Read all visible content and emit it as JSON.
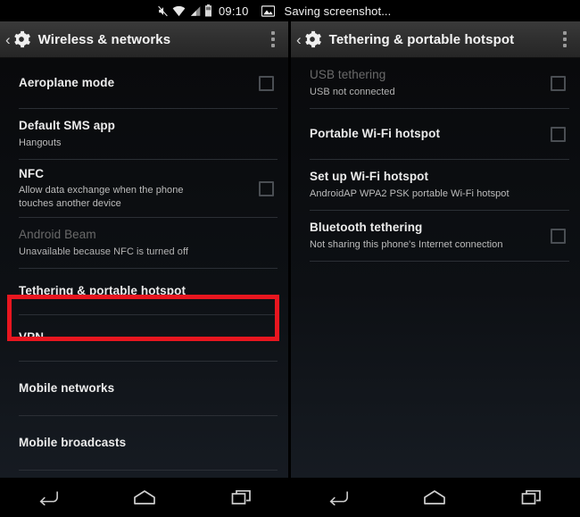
{
  "statusbar": {
    "icons": [
      "mute-icon",
      "wifi-icon",
      "cellular-signal-icon",
      "battery-icon"
    ],
    "clock": "09:10",
    "notification_icon": "screenshot-image-icon",
    "notification_text": "Saving screenshot..."
  },
  "left_panel": {
    "actionbar": {
      "back_icon": "back-chevron-icon",
      "app_icon": "settings-gear-icon",
      "title": "Wireless & networks",
      "overflow_icon": "overflow-menu-icon"
    },
    "rows": [
      {
        "title": "Aeroplane mode",
        "sub": "",
        "checkbox": true,
        "disabled": false
      },
      {
        "title": "Default SMS app",
        "sub": "Hangouts",
        "checkbox": false,
        "disabled": false
      },
      {
        "title": "NFC",
        "sub": "Allow data exchange when the phone touches another device",
        "checkbox": true,
        "disabled": false
      },
      {
        "title": "Android Beam",
        "sub": "Unavailable because NFC is turned off",
        "checkbox": false,
        "disabled": true
      },
      {
        "title": "Tethering & portable hotspot",
        "sub": "",
        "checkbox": false,
        "disabled": false
      },
      {
        "title": "VPN",
        "sub": "",
        "checkbox": false,
        "disabled": false
      },
      {
        "title": "Mobile networks",
        "sub": "",
        "checkbox": false,
        "disabled": false
      },
      {
        "title": "Mobile broadcasts",
        "sub": "",
        "checkbox": false,
        "disabled": false
      }
    ]
  },
  "right_panel": {
    "actionbar": {
      "back_icon": "back-chevron-icon",
      "app_icon": "settings-gear-icon",
      "title": "Tethering & portable hotspot",
      "overflow_icon": "overflow-menu-icon"
    },
    "rows": [
      {
        "title": "USB tethering",
        "sub": "USB not connected",
        "checkbox": true,
        "disabled": true
      },
      {
        "title": "Portable Wi-Fi hotspot",
        "sub": "",
        "checkbox": true,
        "disabled": false
      },
      {
        "title": "Set up Wi-Fi hotspot",
        "sub": "AndroidAP WPA2 PSK portable Wi-Fi hotspot",
        "checkbox": false,
        "disabled": false
      },
      {
        "title": "Bluetooth tethering",
        "sub": "Not sharing this phone's Internet connection",
        "checkbox": true,
        "disabled": false
      }
    ]
  },
  "highlight": {
    "color": "#e8161f",
    "target": "Tethering & portable hotspot"
  },
  "navbar": {
    "back_label": "back-icon",
    "home_label": "home-icon",
    "recents_label": "recents-icon"
  }
}
